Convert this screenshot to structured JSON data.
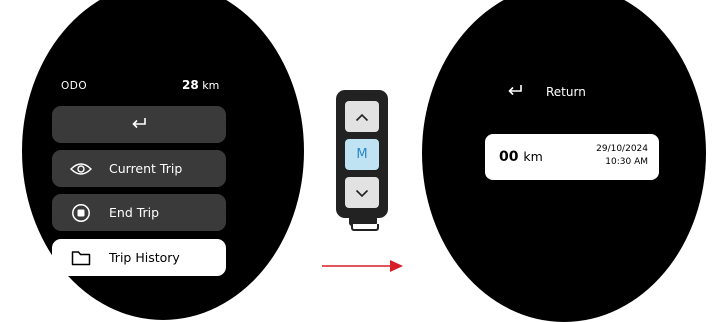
{
  "left_screen": {
    "odo_label": "ODO",
    "odo_value": "28",
    "odo_unit": "km",
    "menu": [
      {
        "label": "",
        "icon": "return-arrow-icon"
      },
      {
        "label": "Current Trip",
        "icon": "eye-icon"
      },
      {
        "label": "End Trip",
        "icon": "stop-circle-icon"
      },
      {
        "label": "Trip History",
        "icon": "folder-icon",
        "selected": true
      }
    ]
  },
  "controller": {
    "up_icon": "chevron-up-icon",
    "mode_label": "M",
    "down_icon": "chevron-down-icon"
  },
  "right_screen": {
    "return_label": "Return",
    "trip": {
      "distance": "00",
      "unit": "km",
      "date": "29/10/2024",
      "time": "10:30 AM"
    }
  },
  "colors": {
    "screen_bg": "#000000",
    "pill_bg": "#3a3a3a",
    "selected_pill_bg": "#ffffff",
    "mode_button_bg": "#bfe3f2",
    "arrow": "#d61f26"
  }
}
